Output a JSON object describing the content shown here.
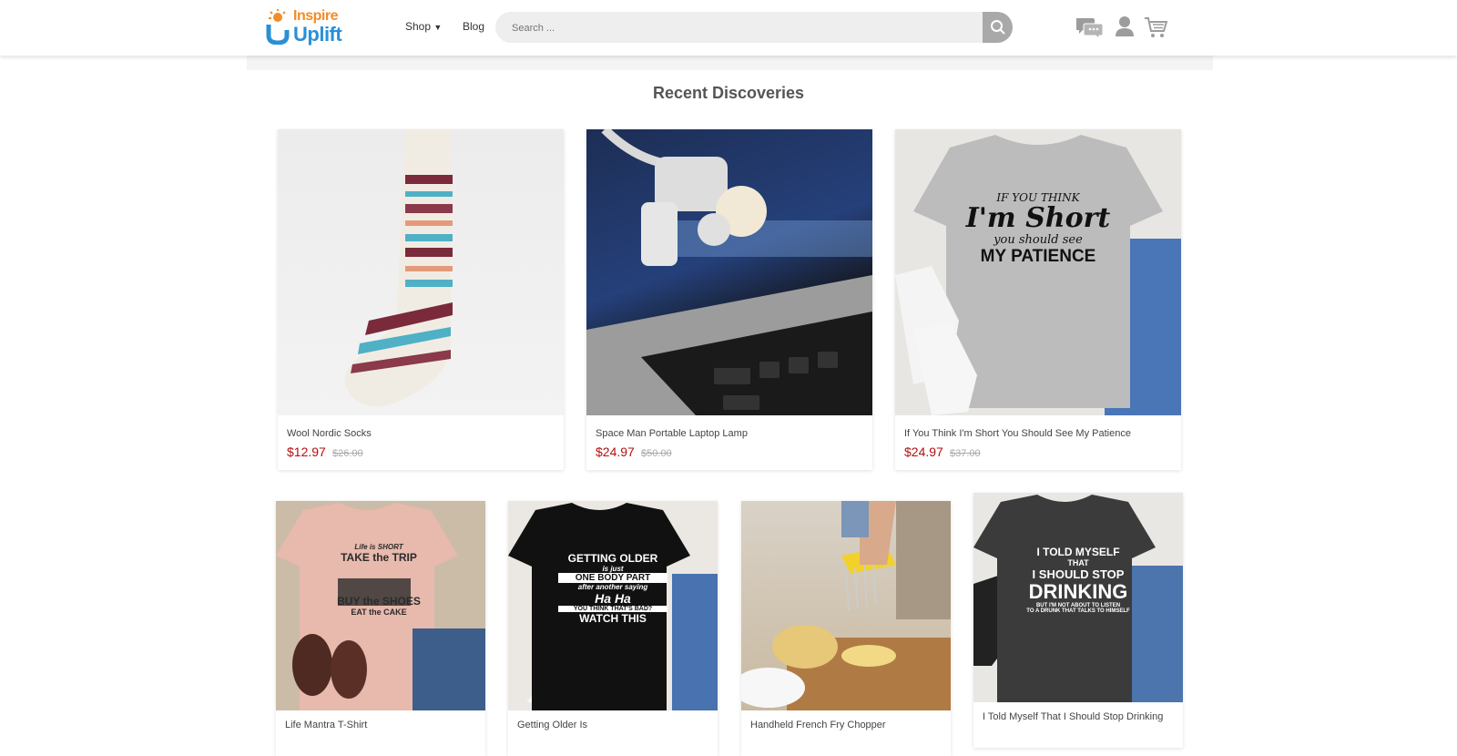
{
  "header": {
    "logo_line1": "Inspire",
    "logo_line2": "Uplift",
    "nav_shop": "Shop",
    "nav_blog": "Blog",
    "search_placeholder": "Search ..."
  },
  "section_title": "Recent Discoveries",
  "products": [
    {
      "name": "Wool Nordic Socks",
      "price": "$12.97",
      "old_price": "$26.00"
    },
    {
      "name": "Space Man Portable Laptop Lamp",
      "price": "$24.97",
      "old_price": "$50.00"
    },
    {
      "name": "If You Think I'm Short You Should See My Patience",
      "price": "$24.97",
      "old_price": "$37.00",
      "shirt_text": [
        "IF YOU THINK",
        "I'm Short",
        "you should see",
        "MY PATIENCE"
      ]
    },
    {
      "name": "Life Mantra T-Shirt",
      "shirt_text": [
        "Life is SHORT",
        "TAKE the TRIP",
        "BUY the SHOES",
        "EAT the CAKE"
      ]
    },
    {
      "name": "Getting Older Is",
      "shirt_text": [
        "GETTING OLDER",
        "is just",
        "ONE BODY PART",
        "after another saying",
        "Ha Ha",
        "YOU THINK THAT'S BAD?",
        "WATCH THIS"
      ]
    },
    {
      "name": "Handheld French Fry Chopper"
    },
    {
      "name": "I Told Myself That I Should Stop Drinking",
      "shirt_text": [
        "I TOLD MYSELF",
        "THAT",
        "I SHOULD STOP",
        "DRINKING",
        "BUT I'M NOT ABOUT TO LISTEN",
        "TO A DRUNK THAT TALKS TO HIMSELF"
      ]
    }
  ],
  "colors": {
    "price": "#b30f0f",
    "accent": "#2a8fd6"
  }
}
